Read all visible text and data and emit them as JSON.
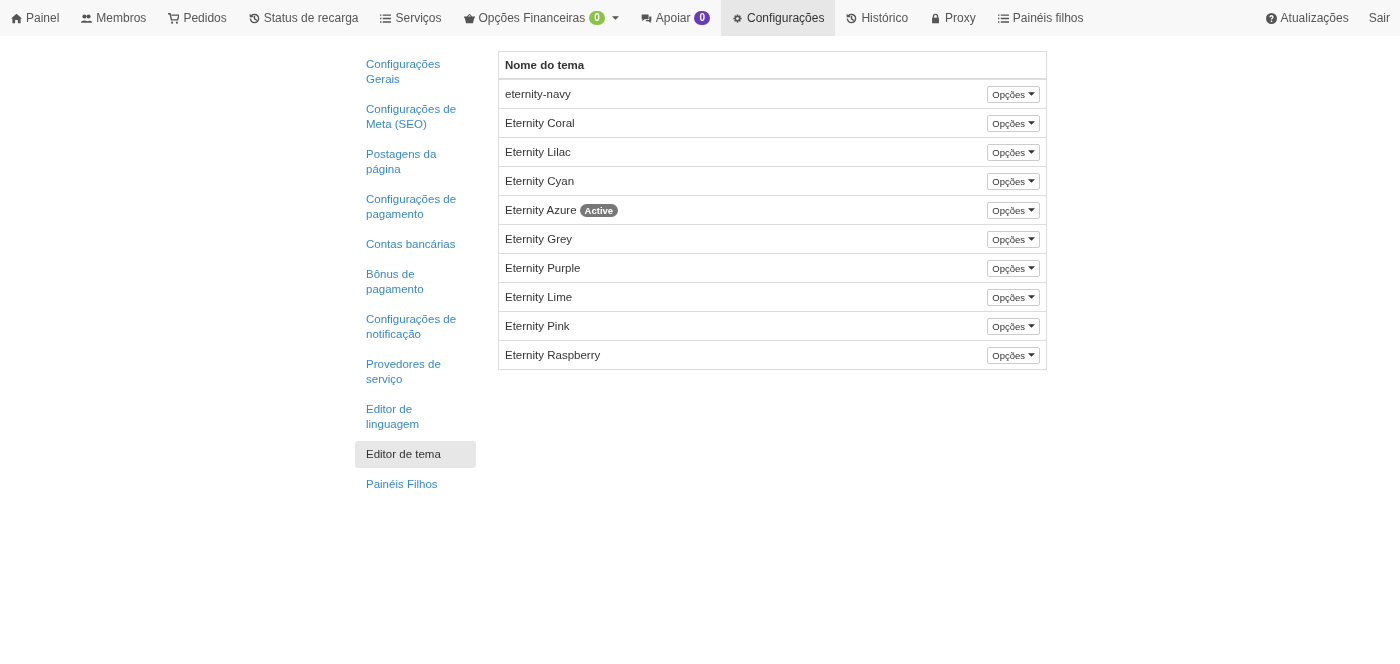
{
  "nav": {
    "items": [
      {
        "label": "Painel",
        "selected": false
      },
      {
        "label": "Membros",
        "selected": false
      },
      {
        "label": "Pedidos",
        "selected": false
      },
      {
        "label": "Status de recarga",
        "selected": false
      },
      {
        "label": "Serviços",
        "selected": false
      },
      {
        "label": "Opções Financeiras",
        "selected": false,
        "badge": {
          "text": "0",
          "color": "#8bc34a"
        },
        "dropdown": true
      },
      {
        "label": "Apoiar",
        "selected": false,
        "badge": {
          "text": "0",
          "color": "#673ab7"
        }
      },
      {
        "label": "Configurações",
        "selected": true
      },
      {
        "label": "Histórico",
        "selected": false
      },
      {
        "label": "Proxy",
        "selected": false
      },
      {
        "label": "Painéis filhos",
        "selected": false
      }
    ],
    "right": [
      {
        "label": "Atualizações"
      },
      {
        "label": "Sair"
      }
    ]
  },
  "sidebar": {
    "items": [
      {
        "label": "Configurações Gerais",
        "selected": false
      },
      {
        "label": "Configurações de Meta (SEO)",
        "selected": false
      },
      {
        "label": "Postagens da página",
        "selected": false
      },
      {
        "label": "Configurações de pagamento",
        "selected": false
      },
      {
        "label": "Contas bancárias",
        "selected": false
      },
      {
        "label": "Bônus de pagamento",
        "selected": false
      },
      {
        "label": "Configurações de notificação",
        "selected": false
      },
      {
        "label": "Provedores de serviço",
        "selected": false
      },
      {
        "label": "Editor de linguagem",
        "selected": false
      },
      {
        "label": "Editor de tema",
        "selected": true
      },
      {
        "label": "Painéis Filhos",
        "selected": false
      }
    ]
  },
  "table": {
    "columns": [
      "Nome do tema"
    ],
    "rows": [
      {
        "name": "eternity-navy",
        "button": "Opções"
      },
      {
        "name": "Eternity Coral",
        "button": "Opções"
      },
      {
        "name": "Eternity Lilac",
        "button": "Opções"
      },
      {
        "name": "Eternity Cyan",
        "button": "Opções"
      },
      {
        "name": "Eternity Azure",
        "badge": "Active",
        "button": "Opções"
      },
      {
        "name": "Eternity Grey",
        "button": "Opções"
      },
      {
        "name": "Eternity Purple",
        "button": "Opções"
      },
      {
        "name": "Eternity Lime",
        "button": "Opções"
      },
      {
        "name": "Eternity Pink",
        "button": "Opções"
      },
      {
        "name": "Eternity Raspberry",
        "button": "Opções"
      }
    ]
  }
}
